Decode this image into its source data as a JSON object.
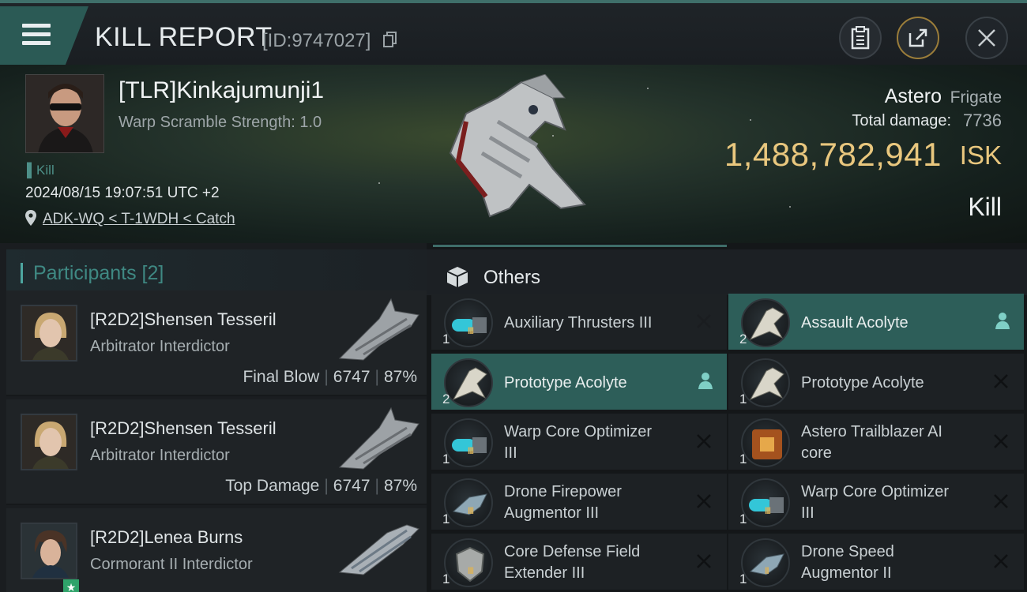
{
  "header": {
    "title": "KILL REPORT",
    "kill_id": "[ID:9747027]"
  },
  "victim": {
    "name": "[TLR]Kinkajumunji1",
    "warp_scramble": "Warp Scramble Strength: 1.0",
    "tag": "Kill",
    "datetime": "2024/08/15 19:07:51 UTC +2",
    "location": "ADK-WQ < T-1WDH < Catch"
  },
  "ship": {
    "name": "Astero",
    "class": "Frigate",
    "total_damage_label": "Total damage:",
    "total_damage": "7736",
    "isk_value": "1,488,782,941",
    "isk_unit": "ISK",
    "result": "Kill"
  },
  "participants": {
    "title": "Participants [2]",
    "rows": [
      {
        "name": "[R2D2]Shensen Tesseril",
        "ship": "Arbitrator Interdictor",
        "label": "Final Blow",
        "damage": "6747",
        "percent": "87%"
      },
      {
        "name": "[R2D2]Shensen Tesseril",
        "ship": "Arbitrator Interdictor",
        "label": "Top Damage",
        "damage": "6747",
        "percent": "87%"
      },
      {
        "name": "[R2D2]Lenea Burns",
        "ship": "Cormorant II Interdictor",
        "label": "",
        "damage": "",
        "percent": ""
      }
    ]
  },
  "others": {
    "title": "Others",
    "items": [
      {
        "label": "Auxiliary Thrusters III",
        "qty": "1",
        "tech": "III",
        "icon": "thruster-icon"
      },
      {
        "label": "Assault Acolyte",
        "qty": "2",
        "tech": "",
        "icon": "drone-icon"
      },
      {
        "label": "Prototype  Acolyte",
        "qty": "2",
        "tech": "",
        "icon": "drone-icon"
      },
      {
        "label": "Prototype  Acolyte",
        "qty": "1",
        "tech": "",
        "icon": "drone-icon"
      },
      {
        "label1": "Warp Core Optimizer",
        "label2": "III",
        "qty": "1",
        "tech": "III",
        "icon": "optimizer-icon"
      },
      {
        "label1": "Astero Trailblazer AI",
        "label2": "core",
        "qty": "1",
        "tech": "",
        "icon": "ai-core-icon"
      },
      {
        "label1": "Drone Firepower",
        "label2": "Augmentor III",
        "qty": "1",
        "tech": "III",
        "icon": "augmentor-icon"
      },
      {
        "label1": "Warp Core Optimizer",
        "label2": "III",
        "qty": "1",
        "tech": "III",
        "icon": "optimizer-icon"
      },
      {
        "label1": "Core Defense Field",
        "label2": "Extender III",
        "qty": "1",
        "tech": "III",
        "icon": "shield-extender-icon"
      },
      {
        "label1": "Drone Speed",
        "label2": "Augmentor II",
        "qty": "1",
        "tech": "II",
        "icon": "augmentor-icon"
      }
    ]
  },
  "colors": {
    "accent": "#2d5e59",
    "isk": "#e9c77e",
    "teal_text": "#3f8983"
  }
}
